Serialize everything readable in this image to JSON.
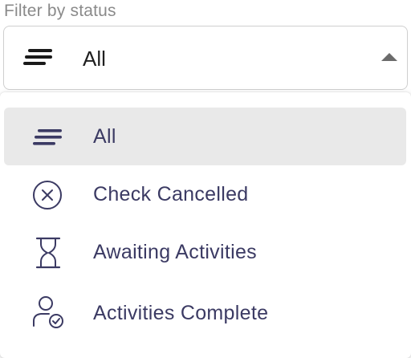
{
  "filter": {
    "label": "Filter by status",
    "selected_value": "All",
    "selected_icon": "lines-icon"
  },
  "dropdown": {
    "options": [
      {
        "label": "All",
        "icon": "lines-icon",
        "selected": true
      },
      {
        "label": "Check Cancelled",
        "icon": "circle-x-icon",
        "selected": false
      },
      {
        "label": "Awaiting Activities",
        "icon": "hourglass-icon",
        "selected": false
      },
      {
        "label": "Activities Complete",
        "icon": "user-check-icon",
        "selected": false
      }
    ]
  },
  "colors": {
    "option_text": "#3b3a63",
    "icon_accent": "#3b3a63",
    "selected_bg": "#e9e9e9",
    "label_text": "#8a8a8a"
  }
}
